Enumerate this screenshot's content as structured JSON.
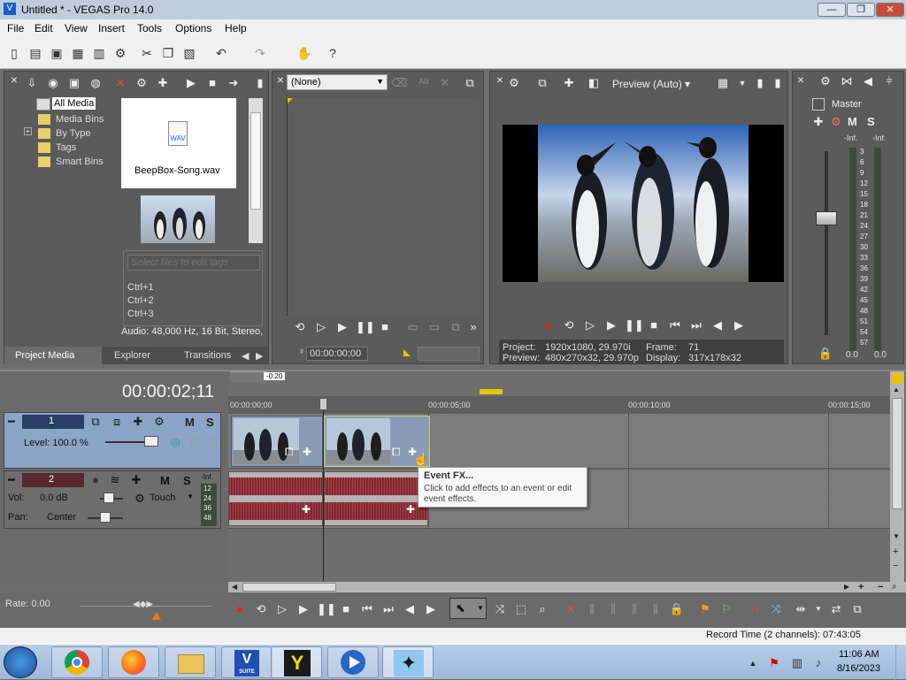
{
  "window": {
    "title": "Untitled * - VEGAS Pro 14.0",
    "min": "—",
    "max": "❐",
    "close": "✕"
  },
  "menu": [
    "File",
    "Edit",
    "View",
    "Insert",
    "Tools",
    "Options",
    "Help"
  ],
  "project_media": {
    "tree": [
      "All Media",
      "Media Bins",
      "By Type",
      "Tags",
      "Smart Bins"
    ],
    "tree_expander": "+",
    "file_name": "BeepBox-Song.wav",
    "file_icon_label": "WAV",
    "tags_placeholder": "Select files to edit tags",
    "shortcuts": [
      "Ctrl+1",
      "Ctrl+2",
      "Ctrl+3"
    ],
    "info": "Audio: 48,000 Hz, 16 Bit, Stereo,",
    "tabs": [
      "Project Media",
      "Explorer",
      "Transitions"
    ]
  },
  "trimmer": {
    "select": "(None)",
    "timecode": "00:00:00;00"
  },
  "preview": {
    "mode": "Preview (Auto)",
    "project_label": "Project:",
    "project_value": "1920x1080, 29.970i",
    "frame_label": "Frame:",
    "frame_value": "71",
    "preview_label": "Preview:",
    "preview_value": "480x270x32, 29.970p",
    "display_label": "Display:",
    "display_value": "317x178x32"
  },
  "master": {
    "title": "Master",
    "m": "M",
    "s": "S",
    "inf_left": "-Inf.",
    "inf_right": "-Inf.",
    "scale": [
      "3",
      "6",
      "9",
      "12",
      "15",
      "18",
      "21",
      "24",
      "27",
      "30",
      "33",
      "36",
      "39",
      "42",
      "45",
      "48",
      "51",
      "54",
      "57"
    ],
    "val_left": "0.0",
    "val_right": "0.0"
  },
  "timeline": {
    "timecode": "00:00:02;11",
    "loop_label": "-0:20",
    "ruler": [
      "00:00:00;00",
      "00:00:05;00",
      "00:00:10;00",
      "00:00:15;00"
    ],
    "track1": {
      "num": "1",
      "m": "M",
      "s": "S",
      "level": "Level: 100.0 %"
    },
    "track2": {
      "num": "2",
      "m": "M",
      "s": "S",
      "vol_label": "Vol:",
      "vol": "0.0 dB",
      "touch": "Touch",
      "pan_label": "Pan:",
      "pan": "Center",
      "meter_inf": "-Inf.",
      "meter": [
        "12",
        "24",
        "36",
        "48"
      ]
    },
    "tooltip_title": "Event FX...",
    "tooltip_text": "Click to add effects to an event or edit event effects.",
    "rate": "Rate: 0.00",
    "record_time": "Record Time (2 channels): 07:43:05"
  },
  "taskbar": {
    "time": "11:06 AM",
    "date": "8/16/2023",
    "app_v": "V",
    "app_v_sub": "SUITE",
    "app_y": "Y"
  },
  "colors": {
    "accent_yellow": "#e8c400",
    "record_red": "#e02020"
  }
}
